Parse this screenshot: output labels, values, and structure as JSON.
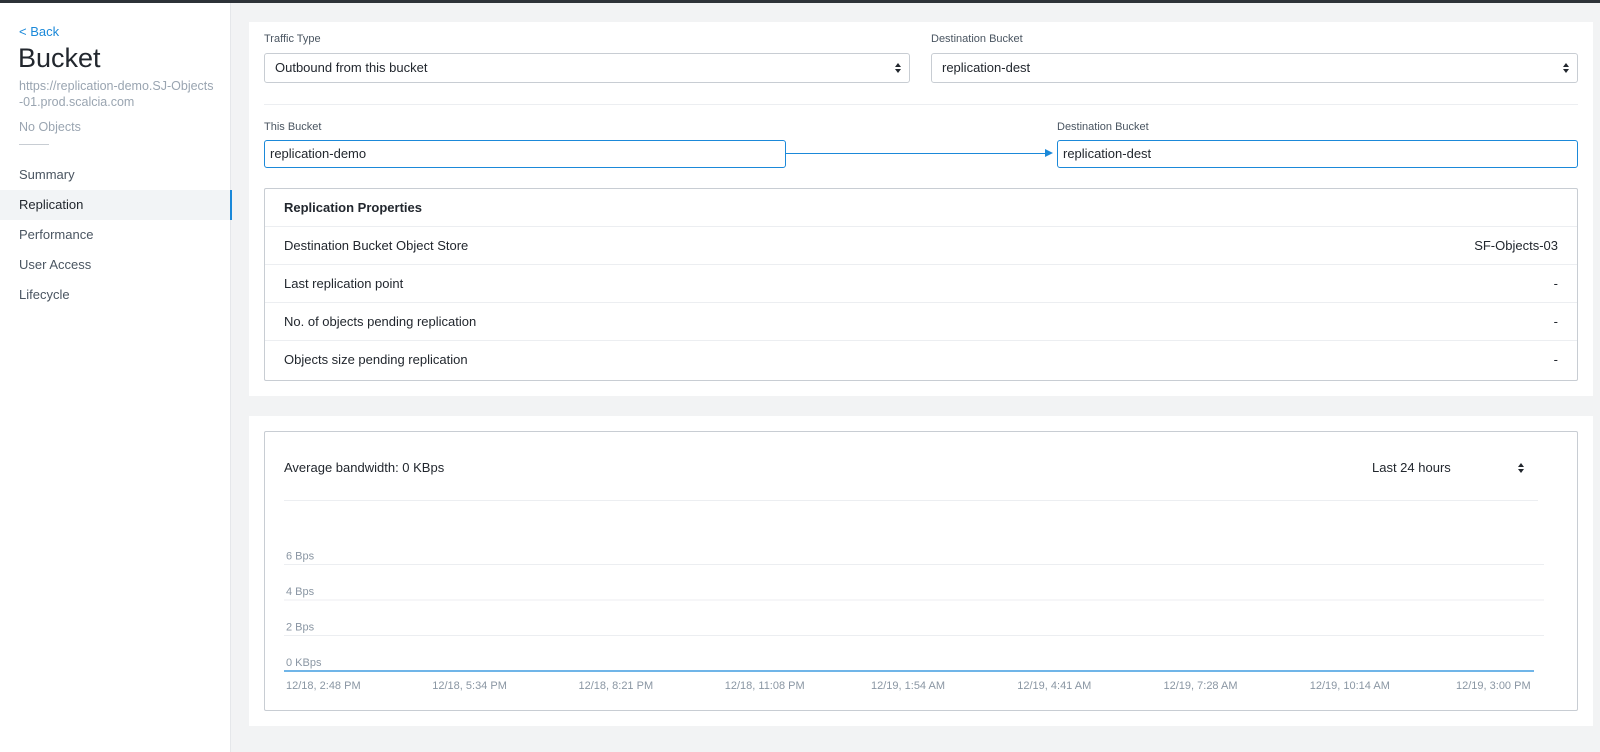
{
  "sidebar": {
    "back_label": "< Back",
    "title": "Bucket",
    "url": "https://replication-demo.SJ-Objects-01.prod.scalcia.com",
    "objects_status": "No Objects",
    "items": [
      {
        "label": "Summary",
        "active": false
      },
      {
        "label": "Replication",
        "active": true
      },
      {
        "label": "Performance",
        "active": false
      },
      {
        "label": "User Access",
        "active": false
      },
      {
        "label": "Lifecycle",
        "active": false
      }
    ]
  },
  "config": {
    "traffic_type_label": "Traffic Type",
    "traffic_type_value": "Outbound from this bucket",
    "dest_bucket_label": "Destination Bucket",
    "dest_bucket_value": "replication-dest"
  },
  "flow": {
    "this_bucket_label": "This Bucket",
    "this_bucket_value": "replication-demo",
    "dest_bucket_label": "Destination Bucket",
    "dest_bucket_value": "replication-dest"
  },
  "properties": {
    "title": "Replication Properties",
    "rows": [
      {
        "label": "Destination Bucket Object Store",
        "value": "SF-Objects-03"
      },
      {
        "label": "Last replication point",
        "value": "-"
      },
      {
        "label": "No. of objects pending replication",
        "value": "-"
      },
      {
        "label": "Objects size pending replication",
        "value": "-"
      }
    ]
  },
  "bandwidth": {
    "title": "Average bandwidth: 0 KBps",
    "range": "Last 24 hours"
  },
  "chart_data": {
    "type": "line",
    "title": "",
    "xlabel": "",
    "ylabel": "",
    "y_ticks": [
      "6 Bps",
      "4 Bps",
      "2 Bps",
      "0 KBps"
    ],
    "y_tick_values": [
      6,
      4,
      2,
      0
    ],
    "ylim": [
      0,
      8
    ],
    "x": [
      "12/18, 2:48 PM",
      "12/18, 5:34 PM",
      "12/18, 8:21 PM",
      "12/18, 11:08 PM",
      "12/19, 1:54 AM",
      "12/19, 4:41 AM",
      "12/19, 7:28 AM",
      "12/19, 10:14 AM",
      "12/19, 3:00 PM"
    ],
    "series": [
      {
        "values": [
          0,
          0,
          0,
          0,
          0,
          0,
          0,
          0,
          0
        ],
        "color": "#1b89d9"
      }
    ],
    "grid": true
  }
}
